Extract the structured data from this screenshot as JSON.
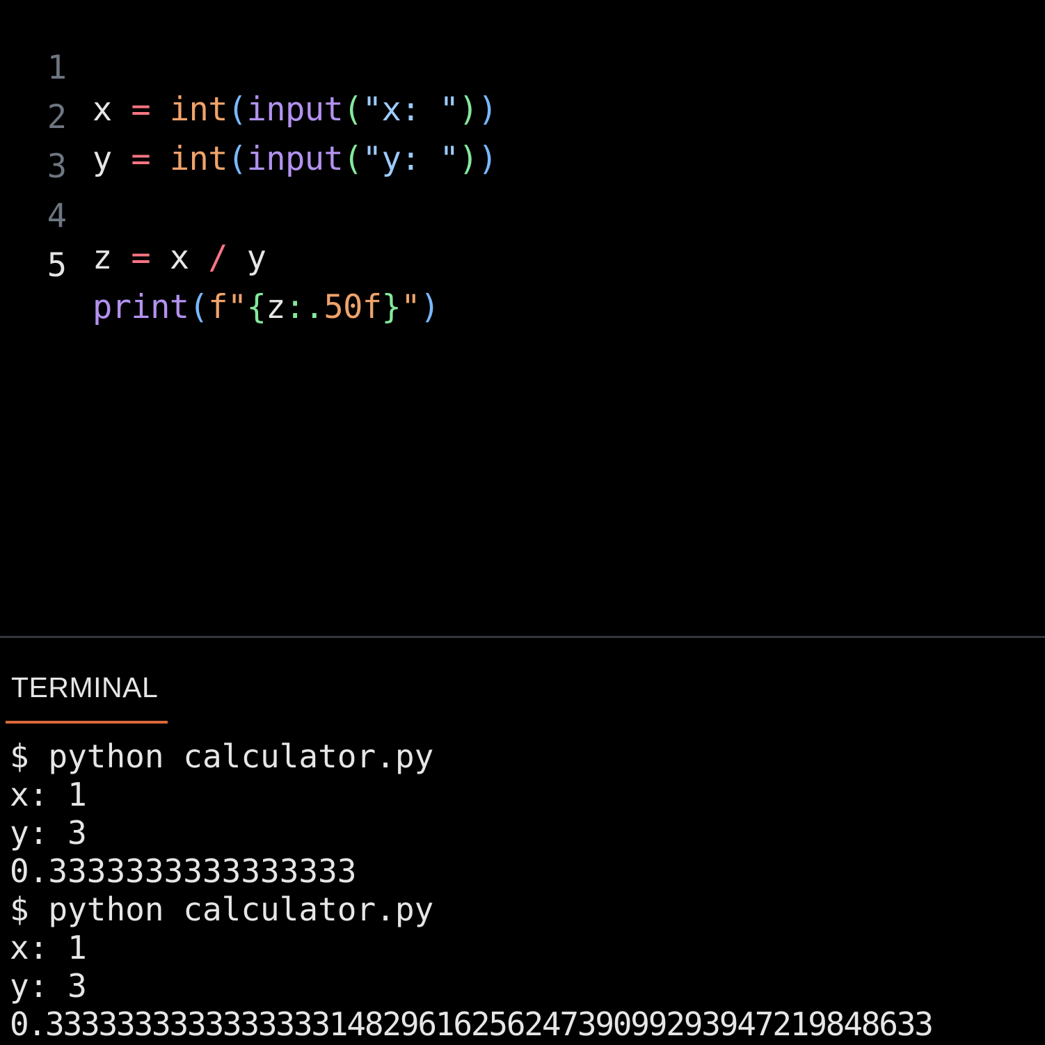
{
  "colors": {
    "background": "#000000",
    "line_number": "#6e7681",
    "line_number_active": "#e6e6e6",
    "operator": "#f97583",
    "builtin": "#f0a36b",
    "function": "#b392f0",
    "string": "#9ecbff",
    "format_spec": "#85e89d",
    "terminal_tab_accent": "#d9683a"
  },
  "editor": {
    "lines": [
      {
        "number": "1",
        "tokens": {
          "var": "x",
          "op": "=",
          "builtin": "int",
          "p1": "(",
          "fn": "input",
          "p2": "(",
          "str": "\"x: \"",
          "p3": ")",
          "p4": ")"
        }
      },
      {
        "number": "2",
        "tokens": {
          "var": "y",
          "op": "=",
          "builtin": "int",
          "p1": "(",
          "fn": "input",
          "p2": "(",
          "str": "\"y: \"",
          "p3": ")",
          "p4": ")"
        }
      },
      {
        "number": "3"
      },
      {
        "number": "4",
        "tokens": {
          "var1": "z",
          "op1": "=",
          "var2": "x",
          "op2": "/",
          "var3": "y"
        }
      },
      {
        "number": "5",
        "tokens": {
          "fn": "print",
          "p1": "(",
          "prefix": "f\"",
          "brace_open": "{",
          "var": "z",
          "colon": ":.",
          "num": "50f",
          "brace_close": "}",
          "quote": "\"",
          "p2": ")"
        }
      }
    ]
  },
  "terminal": {
    "tab_label": "TERMINAL",
    "lines": [
      "$ python calculator.py",
      "x: 1",
      "y: 3",
      "0.3333333333333333",
      "$ python calculator.py",
      "x: 1",
      "y: 3",
      "0.33333333333333331482961625624739099293947219848633"
    ]
  }
}
